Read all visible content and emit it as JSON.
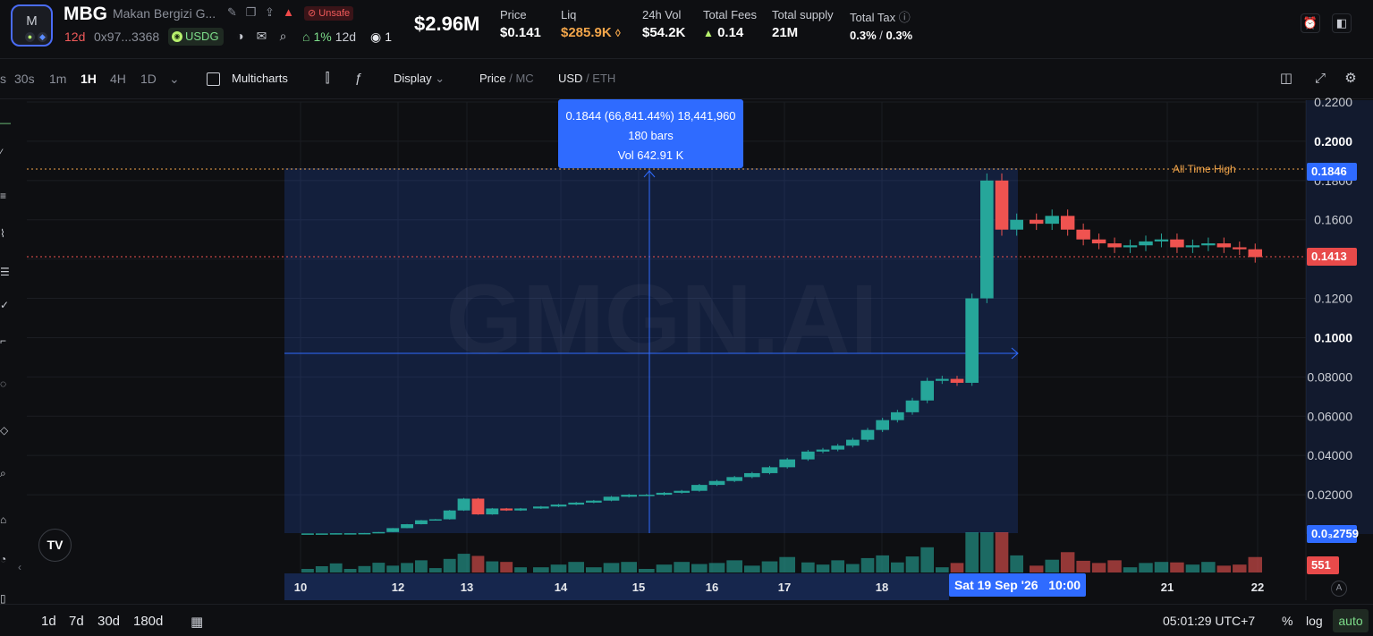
{
  "token": {
    "symbol": "MBG",
    "name": "Makan Bergizi G...",
    "age": "12d",
    "address": "0x97...3368",
    "unsafe_label": "Unsafe",
    "quote": "USDG",
    "holders_pct": "1%",
    "holders_age": "12d",
    "watchers": "1",
    "avatar_letter": "M"
  },
  "header_stats": {
    "market_cap": "$2.96M",
    "price": {
      "label": "Price",
      "value": "$0.141"
    },
    "liq": {
      "label": "Liq",
      "value": "$285.9K"
    },
    "vol24": {
      "label": "24h Vol",
      "value": "$54.2K"
    },
    "fees": {
      "label": "Total Fees",
      "value": "0.14"
    },
    "supply": {
      "label": "Total supply",
      "value": "21M"
    },
    "tax": {
      "label": "Total Tax",
      "buy": "0.3%",
      "sep": " / ",
      "sell": "0.3%"
    }
  },
  "toolbar": {
    "timeframes": [
      "s",
      "30s",
      "1m",
      "1H",
      "4H",
      "1D"
    ],
    "active_timeframe": "1H",
    "multicharts": "Multicharts",
    "display": "Display",
    "price_mc": {
      "main": "Price",
      "sep": " / ",
      "alt": "MC"
    },
    "currency": {
      "main": "USD",
      "sep": " / ",
      "alt": "ETH"
    }
  },
  "chart_overlay": {
    "measure_line1": "0.1844 (66,841.44%) 18,441,960",
    "measure_line2": "180 bars",
    "measure_line3": "Vol 642.91 K",
    "ath_label": "All Time High",
    "ath_tag": "0.1846",
    "last_tag": "0.1413",
    "low_tag": "0.0₃2759",
    "vol_tag": "551",
    "crosshair_date": "Sat 19 Sep '26",
    "crosshair_time": "10:00",
    "watermark": "GMGN.AI",
    "logo": "TV"
  },
  "chart_data": {
    "type": "candlestick",
    "y_axis_ticks": [
      "0.2200",
      "0.2000",
      "0.1800",
      "0.1600",
      "0.1400",
      "0.1200",
      "0.1000",
      "0.08000",
      "0.06000",
      "0.04000",
      "0.02000"
    ],
    "y_axis_bold": [
      "0.2000",
      "0.1000"
    ],
    "ylim": [
      0,
      0.22
    ],
    "x_axis_ticks": [
      "10",
      "12",
      "13",
      "14",
      "15",
      "16",
      "17",
      "18",
      "21",
      "22"
    ],
    "close_series": [
      [
        0.0003,
        0.0003,
        0.0004,
        0.0004,
        0.0005,
        0.001,
        0.003,
        0.005,
        0.007,
        0.0075,
        0.012,
        0.018,
        0.01,
        0.013,
        0.012,
        0.013
      ],
      [
        0.014,
        0.015,
        0.016,
        0.017,
        0.019,
        0.02,
        0.02,
        0.021,
        0.022,
        0.025,
        0.027,
        0.029,
        0.031,
        0.034,
        0.038
      ],
      [
        0.042,
        0.043,
        0.045,
        0.048,
        0.053,
        0.058,
        0.062,
        0.068,
        0.078,
        0.079,
        0.077,
        0.12,
        0.18,
        0.155,
        0.16
      ],
      [
        0.158,
        0.162,
        0.155,
        0.15,
        0.148,
        0.146,
        0.147,
        0.149,
        0.15,
        0.146,
        0.147,
        0.148,
        0.146,
        0.145,
        0.141
      ]
    ],
    "all_time_high": 0.1846,
    "last_price": 0.1413
  },
  "bottombar": {
    "ranges": [
      "1d",
      "7d",
      "30d",
      "180d"
    ],
    "clock": "05:01:29 UTC+7",
    "pct": "%",
    "log": "log",
    "auto": "auto"
  },
  "colors": {
    "up": "#26a69a",
    "down": "#ef5350",
    "accent": "#2f6bff",
    "ath": "#f2a54a"
  }
}
